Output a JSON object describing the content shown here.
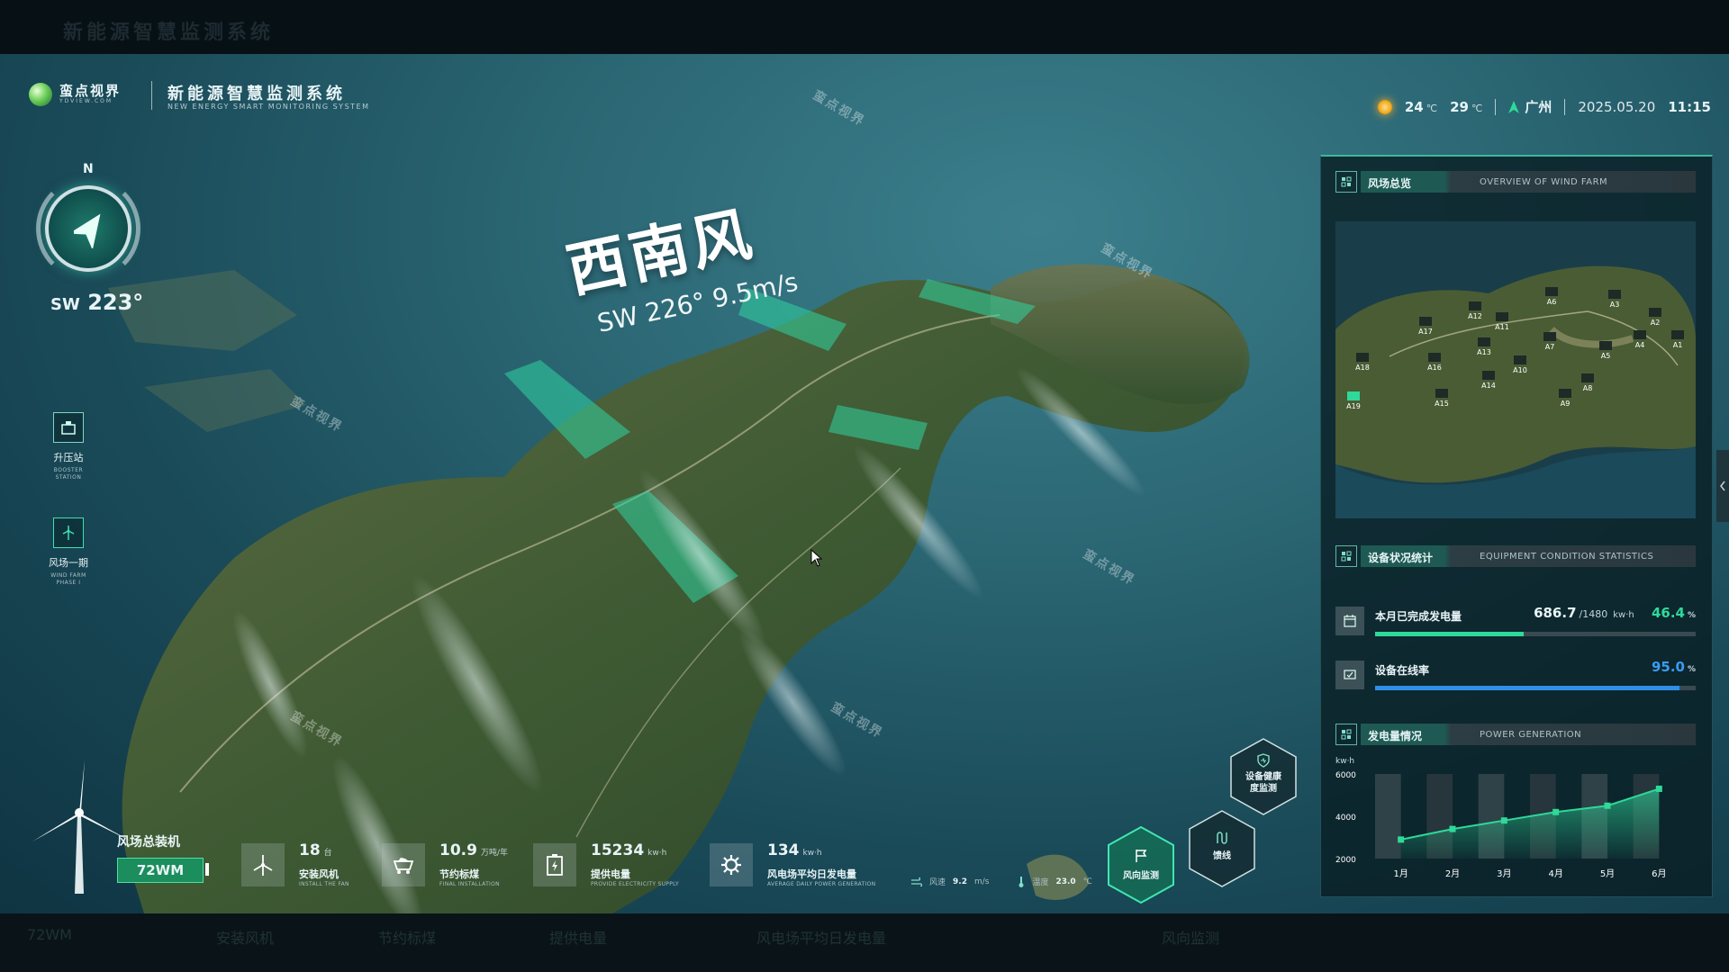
{
  "window": {
    "ghost_title": "新能源智慧监测系统"
  },
  "header": {
    "brand_name": "蛮点视界",
    "brand_sub": "YDVIEW.COM",
    "title": "新能源智慧监测系统",
    "subtitle": "NEW ENERGY SMART MONITORING SYSTEM",
    "weather": {
      "temp_low": "24",
      "temp_high": "29",
      "unit": "℃",
      "icon": "sun-icon"
    },
    "city": "广州",
    "date": "2025.05.20",
    "time": "11:15"
  },
  "compass": {
    "north": "N",
    "direction": "SW",
    "degrees": "223°"
  },
  "sidenav": [
    {
      "label": "升压站",
      "sub1": "BOOSTER",
      "sub2": "STATION",
      "icon": "substation-icon"
    },
    {
      "label": "风场一期",
      "sub1": "WIND FARM",
      "sub2": "PHASE I",
      "icon": "wind-turbine-icon"
    }
  ],
  "wind": {
    "title": "西南风",
    "detail": "SW 226° 9.5m/s"
  },
  "watermark": "蛮点视界",
  "panel": {
    "overview": {
      "title": "风场总览",
      "subtitle": "OVERVIEW OF WIND FARM",
      "turbines": [
        "A17",
        "A12",
        "A11",
        "A6",
        "A3",
        "A2",
        "A4",
        "A1",
        "A13",
        "A7",
        "A5",
        "A18",
        "A16",
        "A10",
        "A14",
        "A8",
        "A15",
        "A9",
        "A19"
      ]
    },
    "equipment": {
      "title": "设备状况统计",
      "subtitle": "EQUIPMENT CONDITION STATISTICS",
      "rows": [
        {
          "label": "本月已完成发电量",
          "value": "686.7",
          "total": "/1480",
          "unit": "kw·h",
          "percent": "46.4",
          "pct_unit": "%",
          "color": "#2ed99a",
          "fraction": 0.464
        },
        {
          "label": "设备在线率",
          "value": "",
          "total": "",
          "unit": "",
          "percent": "95.0",
          "pct_unit": "%",
          "color": "#2f8fe8",
          "fraction": 0.95
        }
      ]
    },
    "generation": {
      "title": "发电量情况",
      "subtitle": "POWER GENERATION"
    }
  },
  "chart_data": {
    "type": "line",
    "ylabel": "kw·h",
    "ylim": [
      2000,
      6000
    ],
    "yticks": [
      "6000",
      "4000",
      "2000"
    ],
    "categories": [
      "1月",
      "2月",
      "3月",
      "4月",
      "5月",
      "6月"
    ],
    "series": [
      {
        "values": [
          2900,
          3400,
          3800,
          4200,
          4500,
          5300
        ]
      }
    ],
    "color": "#2ed99a"
  },
  "bottom": {
    "total": {
      "label": "风场总装机",
      "value": "72WM"
    },
    "stats": [
      {
        "value": "18",
        "unit": "台",
        "label": "安装风机",
        "en": "INSTALL THE FAN",
        "icon": "fan-icon"
      },
      {
        "value": "10.9",
        "unit": "万吨/年",
        "label": "节约标煤",
        "en": "FINAL INSTALLATION",
        "icon": "coal-cart-icon"
      },
      {
        "value": "15234",
        "unit": "kw·h",
        "label": "提供电量",
        "en": "PROVIDE ELECTRICITY SUPPLY",
        "icon": "battery-icon"
      },
      {
        "value": "134",
        "unit": "kw·h",
        "label": "风电场平均日发电量",
        "en": "AVERAGE DAILY POWER GENERATION",
        "icon": "gear-icon"
      }
    ],
    "env": {
      "wind_label": "风速",
      "wind_value": "9.2",
      "wind_unit": "m/s",
      "temp_label": "温度",
      "temp_value": "23.0",
      "temp_unit": "℃"
    },
    "buttons": [
      {
        "label1": "设备健康",
        "label2": "度监测",
        "icon": "shield-heart-icon"
      },
      {
        "label1": "馈线",
        "label2": "",
        "icon": "feeder-icon"
      },
      {
        "label1": "风向监测",
        "label2": "",
        "icon": "flag-icon"
      }
    ]
  }
}
